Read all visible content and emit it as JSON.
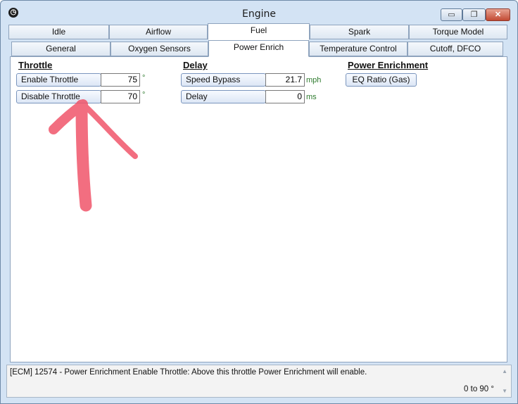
{
  "window": {
    "title": "Engine",
    "min_label": "▭",
    "max_label": "❐",
    "close_label": "✕"
  },
  "tabs_top": [
    {
      "label": "Idle"
    },
    {
      "label": "Airflow"
    },
    {
      "label": "Fuel"
    },
    {
      "label": "Spark"
    },
    {
      "label": "Torque Model"
    }
  ],
  "tabs_sub": [
    {
      "label": "General"
    },
    {
      "label": "Oxygen Sensors"
    },
    {
      "label": "Power Enrich"
    },
    {
      "label": "Temperature Control"
    },
    {
      "label": "Cutoff, DFCO"
    }
  ],
  "sections": {
    "throttle": {
      "heading": "Throttle",
      "enable": {
        "label": "Enable Throttle",
        "value": "75",
        "unit": "°"
      },
      "disable": {
        "label": "Disable Throttle",
        "value": "70",
        "unit": "°"
      }
    },
    "delay": {
      "heading": "Delay",
      "speed_bypass": {
        "label": "Speed Bypass",
        "value": "21.7",
        "unit": "mph"
      },
      "delay": {
        "label": "Delay",
        "value": "0",
        "unit": "ms"
      }
    },
    "power_enrichment": {
      "heading": "Power Enrichment",
      "eq_ratio": {
        "label": "EQ Ratio (Gas)"
      }
    }
  },
  "status": {
    "text": "[ECM] 12574 - Power Enrichment Enable Throttle: Above this throttle Power Enrichment will enable.",
    "range": "0 to 90 °"
  }
}
